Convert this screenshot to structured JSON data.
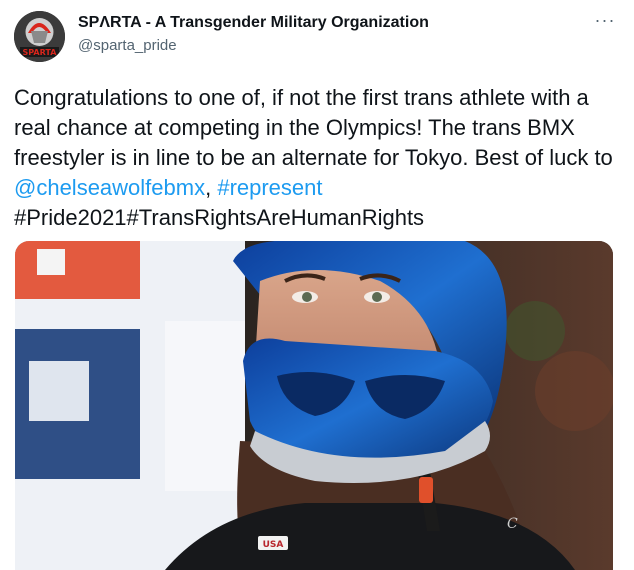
{
  "account": {
    "display_name": "SPΛRTA - A Transgender Military Organization",
    "handle": "@sparta_pride",
    "avatar_text": "SPARTA",
    "avatar_icon": "spartan-helmet-logo"
  },
  "more_menu_label": "···",
  "tweet": {
    "text_part1": "Congratulations to one of, if not the first trans athlete with a real chance at competing in the Olympics! The trans BMX freestyler is in line to be an alternate for Tokyo. Best of luck to ",
    "mention": "@chelseawolfebmx",
    "separator": ", ",
    "hashtag1": "#represent",
    "hashtag2": "#Pride2021#TransRightsAreHumanRights"
  },
  "media": {
    "shirt_text": "USA",
    "shirt_logo": "C"
  },
  "colors": {
    "link": "#1d9bf0",
    "secondary_text": "#536471",
    "helmet_blue": "#1f6fd0"
  }
}
